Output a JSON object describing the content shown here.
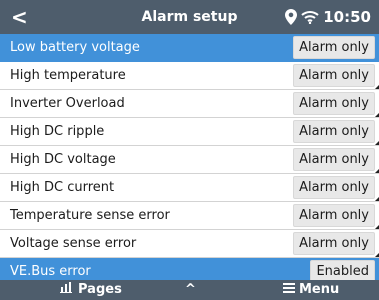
{
  "header": {
    "title": "Alarm setup",
    "time": "10:50",
    "back_icon": "back-chevron-icon",
    "location_icon": "location-pin-icon",
    "wifi_icon": "wifi-icon"
  },
  "rows": [
    {
      "label": "Low battery voltage",
      "value": "Alarm only"
    },
    {
      "label": "High temperature",
      "value": "Alarm only"
    },
    {
      "label": "Inverter Overload",
      "value": "Alarm only"
    },
    {
      "label": "High DC ripple",
      "value": "Alarm only"
    },
    {
      "label": "High DC voltage",
      "value": "Alarm only"
    },
    {
      "label": "High DC current",
      "value": "Alarm only"
    },
    {
      "label": "Temperature sense error",
      "value": "Alarm only"
    },
    {
      "label": "Voltage sense error",
      "value": "Alarm only"
    },
    {
      "label": "VE.Bus error",
      "value": "Enabled"
    }
  ],
  "footer": {
    "pages_label": "Pages",
    "menu_label": "Menu",
    "up_glyph": "^"
  },
  "colors": {
    "topbar": "#4e5d6c",
    "highlight": "#4191d9",
    "value_bg": "#e8e8e8"
  }
}
